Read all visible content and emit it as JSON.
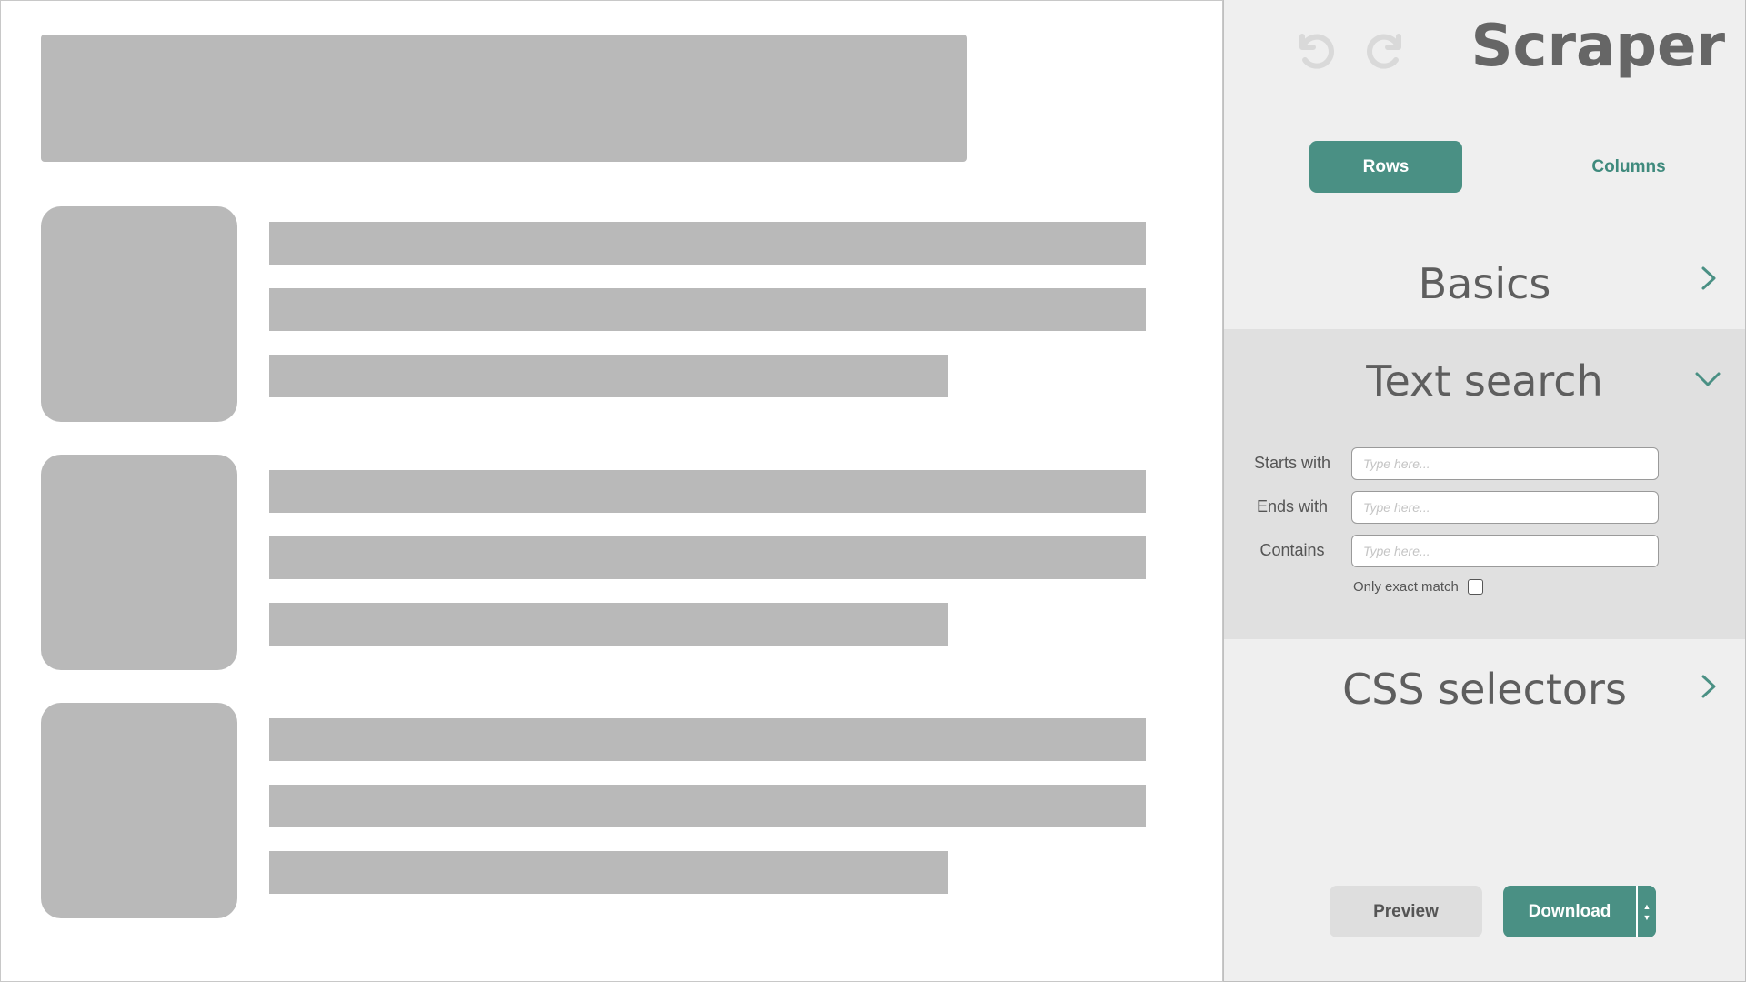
{
  "app": {
    "title": "Scraper"
  },
  "toolbar": {
    "undo_icon": "undo-icon",
    "redo_icon": "redo-icon"
  },
  "mode_tabs": {
    "rows_label": "Rows",
    "columns_label": "Columns",
    "selected": "Rows"
  },
  "sections": {
    "basics": {
      "title": "Basics",
      "state": "collapsed"
    },
    "text_search": {
      "title": "Text search",
      "state": "expanded",
      "fields": [
        {
          "label": "Starts with",
          "value": "",
          "placeholder": "Type here..."
        },
        {
          "label": "Ends with",
          "value": "",
          "placeholder": "Type here..."
        },
        {
          "label": "Contains",
          "value": "",
          "placeholder": "Type here..."
        }
      ],
      "exact_match": {
        "label": "Only exact match",
        "checked": false
      }
    },
    "css_selectors": {
      "title": "CSS selectors",
      "state": "collapsed"
    }
  },
  "actions": {
    "preview_label": "Preview",
    "download_label": "Download",
    "spin_up": "▲",
    "spin_down": "▼"
  },
  "colors": {
    "accent": "#4a9084",
    "placeholder_block": "#b9b9b9",
    "panel_bg": "#efefef",
    "expanded_section_bg": "#e0e0e0"
  }
}
